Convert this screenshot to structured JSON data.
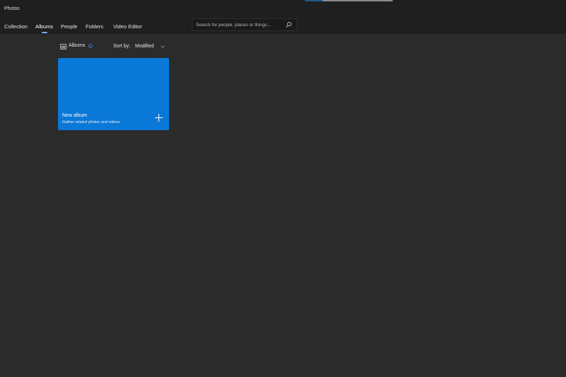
{
  "app": {
    "title": "Photos",
    "progress_percent": 20
  },
  "nav": {
    "tabs": [
      {
        "label": "Collection"
      },
      {
        "label": "Albums",
        "active": true
      },
      {
        "label": "People"
      },
      {
        "label": "Folders"
      },
      {
        "label": "Video Editor"
      }
    ]
  },
  "search": {
    "placeholder": "Search for people, places or things..."
  },
  "toolbar": {
    "albums_label": "Albums",
    "sort_label": "Sort by:",
    "sort_value": "Modified"
  },
  "albums": [
    {
      "title": "New album",
      "subtitle": "Gather related photos and videos"
    }
  ],
  "colors": {
    "accent": "#0a78d7",
    "header_bg": "#1f1f1f",
    "body_bg": "#2b2b2b"
  }
}
